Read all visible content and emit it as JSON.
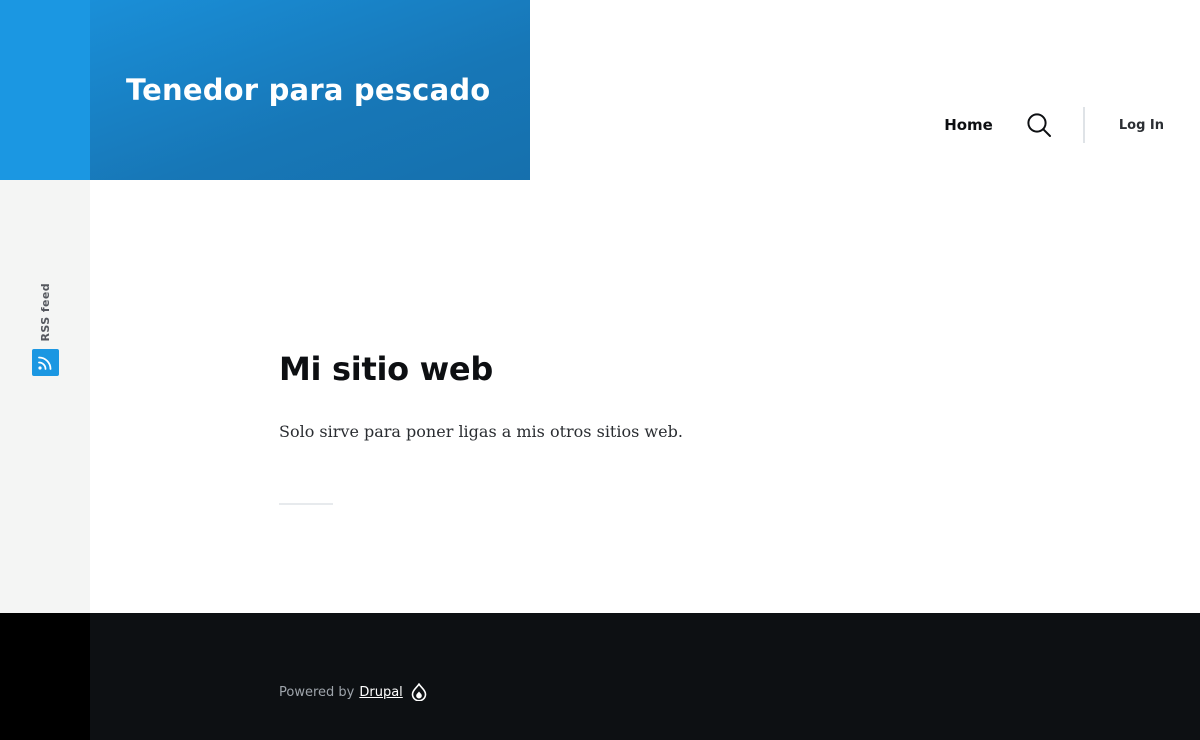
{
  "header": {
    "site_name": "Tenedor para pescado",
    "nav": {
      "home_label": "Home",
      "search_icon": "search-icon",
      "login_label": "Log In"
    }
  },
  "social": {
    "rss_label": "RSS feed",
    "rss_icon": "rss-icon"
  },
  "main": {
    "title": "Mi sitio web",
    "slogan": "Solo sirve para poner ligas a mis otros sitios web."
  },
  "footer": {
    "powered_by_text": "Powered by",
    "powered_by_link": "Drupal",
    "drupal_icon": "drupal-drop-icon"
  },
  "colors": {
    "brand_blue": "#1b97e2",
    "brand_blue_dark": "#1670ad",
    "footer_bg": "#0d1013",
    "rail_bg": "#f4f5f4"
  }
}
